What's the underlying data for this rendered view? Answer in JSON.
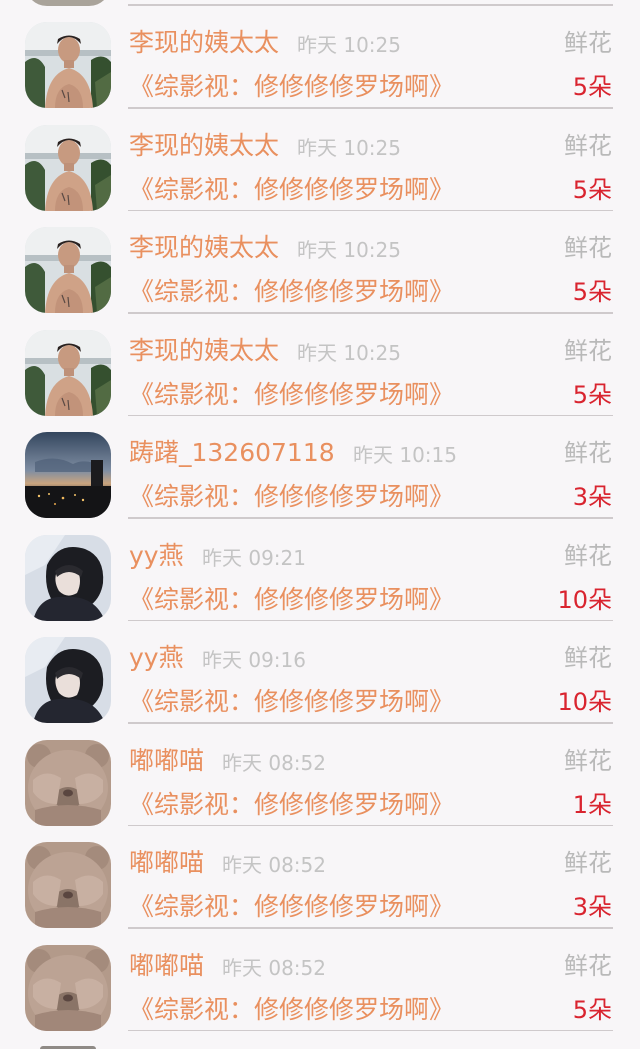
{
  "list": {
    "rows": [
      {
        "name": "李现的姨太太",
        "time": "昨天 10:25",
        "gift": "鲜花",
        "title": "《综影视：修修修修罗场啊》",
        "count": "5朵",
        "avatar": "shirtless-man-avatar"
      },
      {
        "name": "李现的姨太太",
        "time": "昨天 10:25",
        "gift": "鲜花",
        "title": "《综影视：修修修修罗场啊》",
        "count": "5朵",
        "avatar": "shirtless-man-avatar"
      },
      {
        "name": "李现的姨太太",
        "time": "昨天 10:25",
        "gift": "鲜花",
        "title": "《综影视：修修修修罗场啊》",
        "count": "5朵",
        "avatar": "shirtless-man-avatar"
      },
      {
        "name": "李现的姨太太",
        "time": "昨天 10:25",
        "gift": "鲜花",
        "title": "《综影视：修修修修罗场啊》",
        "count": "5朵",
        "avatar": "shirtless-man-avatar"
      },
      {
        "name": "踌躇_132607118",
        "time": "昨天 10:15",
        "gift": "鲜花",
        "title": "《综影视：修修修修罗场啊》",
        "count": "3朵",
        "avatar": "night-city-avatar"
      },
      {
        "name": "yy燕",
        "time": "昨天 09:21",
        "gift": "鲜花",
        "title": "《综影视：修修修修罗场啊》",
        "count": "10朵",
        "avatar": "hooded-person-avatar"
      },
      {
        "name": "yy燕",
        "time": "昨天 09:16",
        "gift": "鲜花",
        "title": "《综影视：修修修修罗场啊》",
        "count": "10朵",
        "avatar": "hooded-person-avatar"
      },
      {
        "name": "嘟嘟喵",
        "time": "昨天 08:52",
        "gift": "鲜花",
        "title": "《综影视：修修修修罗场啊》",
        "count": "1朵",
        "avatar": "teddy-bear-avatar"
      },
      {
        "name": "嘟嘟喵",
        "time": "昨天 08:52",
        "gift": "鲜花",
        "title": "《综影视：修修修修罗场啊》",
        "count": "3朵",
        "avatar": "teddy-bear-avatar"
      },
      {
        "name": "嘟嘟喵",
        "time": "昨天 08:52",
        "gift": "鲜花",
        "title": "《综影视：修修修修罗场啊》",
        "count": "5朵",
        "avatar": "teddy-bear-avatar"
      }
    ]
  },
  "colors": {
    "name": "#e9905f",
    "time": "#c4c4c4",
    "gift": "#b9b9b9",
    "count": "#d9242f",
    "background": "#f8f6f8",
    "divider": "#cfcacc"
  }
}
